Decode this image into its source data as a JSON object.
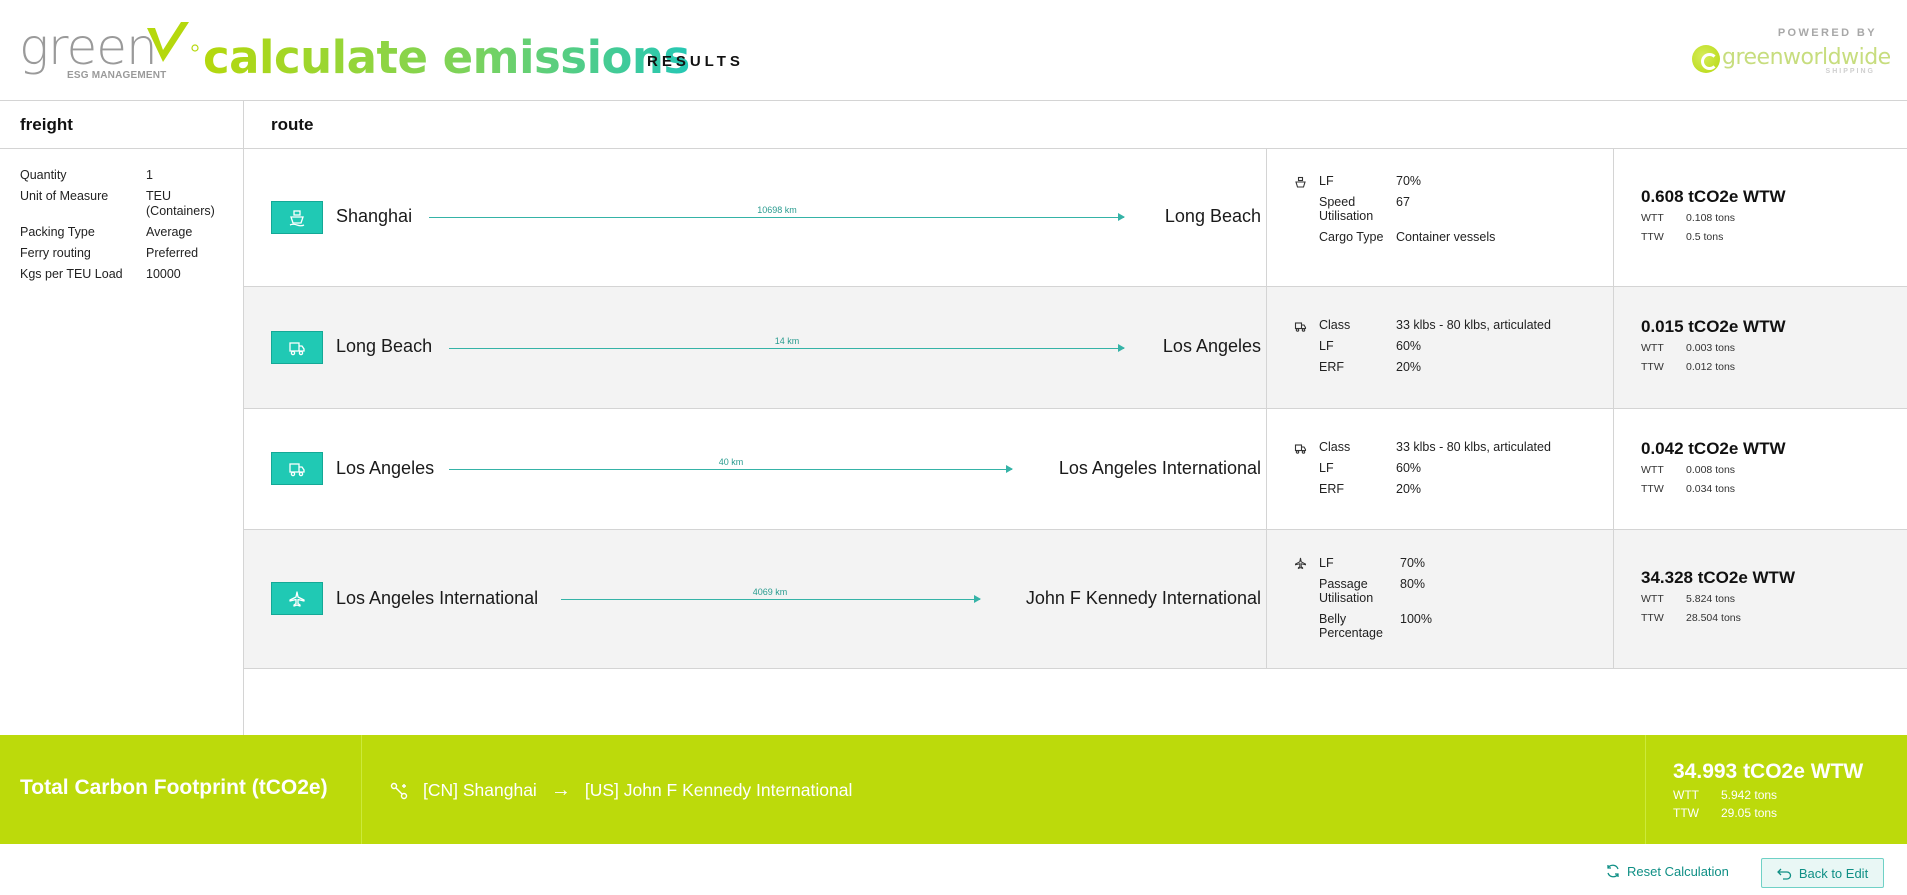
{
  "header": {
    "logo_word": "green",
    "logo_sub": "ESG MANAGEMENT",
    "title": "calculate emissions",
    "subtitle": "RESULTS",
    "powered_by": "POWERED BY",
    "partner_name": "greenworldwide",
    "partner_sub": "SHIPPING",
    "accent_color": "#bcda0b",
    "teal_color": "#20c9b4"
  },
  "freight": {
    "heading": "freight",
    "props": [
      {
        "label": "Quantity",
        "value": "1"
      },
      {
        "label": "Unit of Measure",
        "value": "TEU (Containers)"
      },
      {
        "label": "Packing Type",
        "value": "Average"
      },
      {
        "label": "Ferry routing",
        "value": "Preferred"
      },
      {
        "label": "Kgs per TEU Load",
        "value": "10000"
      }
    ]
  },
  "route": {
    "heading": "route",
    "legs": [
      {
        "mode": "ship-icon",
        "from": "Shanghai",
        "to": "Long Beach",
        "distance": "10698 km",
        "param_icon": "ship-small-icon",
        "params": [
          {
            "label": "LF",
            "value": "70%"
          },
          {
            "label": "Speed Utilisation",
            "value": "67"
          },
          {
            "label": "Cargo Type",
            "value": "Container vessels"
          }
        ],
        "total": "0.608 tCO2e WTW",
        "wtt_label": "WTT",
        "wtt": "0.108 tons",
        "ttw_label": "TTW",
        "ttw": "0.5 tons"
      },
      {
        "mode": "truck-icon",
        "from": "Long Beach",
        "to": "Los Angeles",
        "distance": "14 km",
        "param_icon": "truck-small-icon",
        "params": [
          {
            "label": "Class",
            "value": "33 klbs - 80 klbs, articulated"
          },
          {
            "label": "LF",
            "value": "60%"
          },
          {
            "label": "ERF",
            "value": "20%"
          }
        ],
        "total": "0.015 tCO2e WTW",
        "wtt_label": "WTT",
        "wtt": "0.003 tons",
        "ttw_label": "TTW",
        "ttw": "0.012 tons"
      },
      {
        "mode": "truck-icon",
        "from": "Los Angeles",
        "to": "Los Angeles International",
        "distance": "40 km",
        "param_icon": "truck-small-icon",
        "params": [
          {
            "label": "Class",
            "value": "33 klbs - 80 klbs, articulated"
          },
          {
            "label": "LF",
            "value": "60%"
          },
          {
            "label": "ERF",
            "value": "20%"
          }
        ],
        "total": "0.042 tCO2e WTW",
        "wtt_label": "WTT",
        "wtt": "0.008 tons",
        "ttw_label": "TTW",
        "ttw": "0.034 tons"
      },
      {
        "mode": "plane-icon",
        "from": "Los Angeles International",
        "to": "John F Kennedy International",
        "distance": "4069 km",
        "param_icon": "plane-small-icon",
        "params": [
          {
            "label": "LF",
            "value": "70%"
          },
          {
            "label": "Passage Utilisation",
            "value": "80%"
          },
          {
            "label": "Belly Percentage",
            "value": "100%"
          }
        ],
        "total": "34.328 tCO2e WTW",
        "wtt_label": "WTT",
        "wtt": "5.824 tons",
        "ttw_label": "TTW",
        "ttw": "28.504 tons"
      }
    ]
  },
  "total_bar": {
    "title": "Total Carbon Footprint (tCO2e)",
    "origin": "[CN] Shanghai",
    "destination": "[US] John F Kennedy International",
    "total": "34.993 tCO2e WTW",
    "wtt_label": "WTT",
    "wtt": "5.942 tons",
    "ttw_label": "TTW",
    "ttw": "29.05 tons"
  },
  "actions": {
    "reset_label": "Reset Calculation",
    "back_label": "Back to Edit"
  }
}
